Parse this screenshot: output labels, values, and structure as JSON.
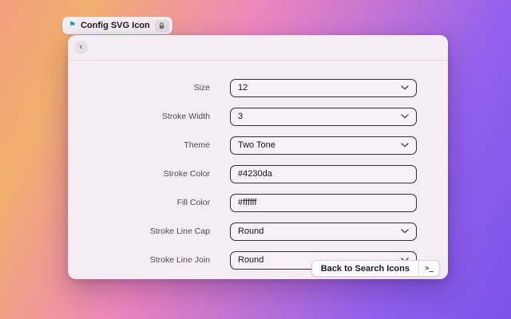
{
  "tab": {
    "title": "Config SVG Icon",
    "flag_glyph": "⚑"
  },
  "window": {
    "back_button_glyph": "‹"
  },
  "form": {
    "rows": [
      {
        "label": "Size",
        "value": "12",
        "type": "select"
      },
      {
        "label": "Stroke Width",
        "value": "3",
        "type": "select"
      },
      {
        "label": "Theme",
        "value": "Two Tone",
        "type": "select"
      },
      {
        "label": "Stroke Color",
        "value": "#4230da",
        "type": "text"
      },
      {
        "label": "Fill Color",
        "value": "#ffffff",
        "type": "text"
      },
      {
        "label": "Stroke Line Cap",
        "value": "Round",
        "type": "select"
      },
      {
        "label": "Stroke Line Join",
        "value": "Round",
        "type": "select"
      }
    ]
  },
  "footer": {
    "back_to_search_label": "Back to Search Icons",
    "terminal_glyph": ">_"
  },
  "colors": {
    "bg_gradient_start": "#f3a07e",
    "bg_gradient_mid": "#ee86bd",
    "bg_gradient_end": "#7b54e8",
    "window_bg": "#f5ecf4",
    "control_border": "#2e2e33",
    "stroke_color_value": "#4230da",
    "fill_color_value": "#ffffff",
    "flag_icon_color": "#18a092"
  }
}
